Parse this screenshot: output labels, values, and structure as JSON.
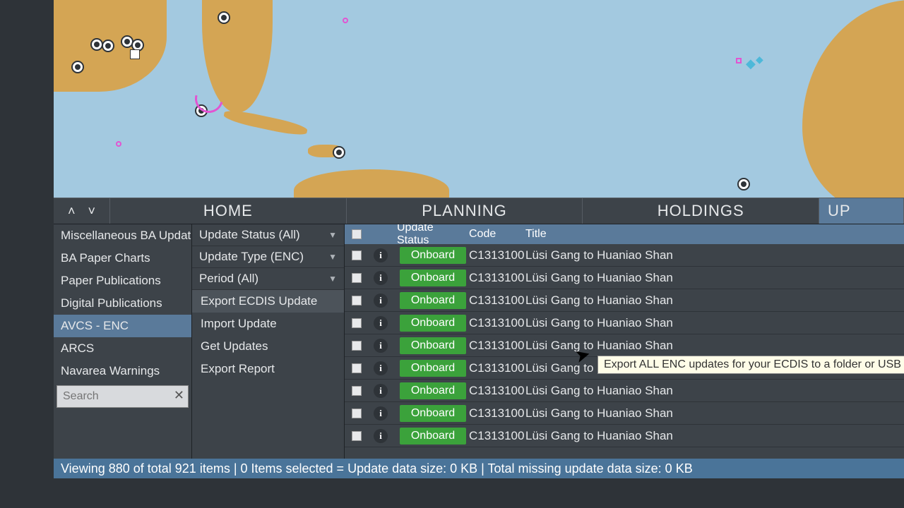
{
  "tabs": {
    "home": "HOME",
    "planning": "PLANNING",
    "holdings": "HOLDINGS",
    "updates_cut": "UP"
  },
  "sidebar": {
    "items": [
      "Miscellaneous BA Updates",
      "BA Paper Charts",
      "Paper Publications",
      "Digital Publications",
      "AVCS - ENC",
      "ARCS",
      "Navarea Warnings"
    ],
    "search_placeholder": "Search"
  },
  "filters": {
    "status": "Update Status (All)",
    "type": "Update Type (ENC)",
    "period": "Period (All)"
  },
  "actions": {
    "export_ecdis": "Export ECDIS Update",
    "import": "Import Update",
    "get": "Get Updates",
    "report": "Export Report"
  },
  "tooltip": "Export ALL ENC updates for your ECDIS to a folder or USB stick",
  "grid": {
    "headers": {
      "status": "Update Status",
      "code": "Code",
      "title": "Title"
    },
    "rows": [
      {
        "status": "Onboard",
        "code": "C1313100",
        "title": "Lüsi Gang to Huaniao Shan"
      },
      {
        "status": "Onboard",
        "code": "C1313100",
        "title": "Lüsi Gang to Huaniao Shan"
      },
      {
        "status": "Onboard",
        "code": "C1313100",
        "title": "Lüsi Gang to Huaniao Shan"
      },
      {
        "status": "Onboard",
        "code": "C1313100",
        "title": "Lüsi Gang to Huaniao Shan"
      },
      {
        "status": "Onboard",
        "code": "C1313100",
        "title": "Lüsi Gang to Huaniao Shan"
      },
      {
        "status": "Onboard",
        "code": "C1313100",
        "title": "Lüsi Gang to Huaniao Shan"
      },
      {
        "status": "Onboard",
        "code": "C1313100",
        "title": "Lüsi Gang to Huaniao Shan"
      },
      {
        "status": "Onboard",
        "code": "C1313100",
        "title": "Lüsi Gang to Huaniao Shan"
      },
      {
        "status": "Onboard",
        "code": "C1313100",
        "title": "Lüsi Gang to Huaniao Shan"
      }
    ]
  },
  "statusbar": "Viewing 880 of total 921 items | 0 Items selected = Update data size: 0 KB | Total missing update data size: 0 KB"
}
